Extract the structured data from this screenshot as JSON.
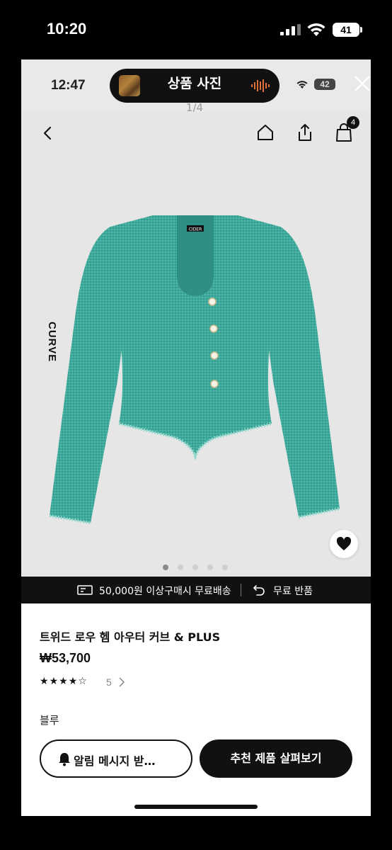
{
  "outer_status": {
    "time": "10:20",
    "battery": "41"
  },
  "inner_status": {
    "time": "12:47",
    "battery": "42"
  },
  "viewer_header": {
    "title": "상품 사진",
    "counter": "1/4",
    "cart_count": "4"
  },
  "product_image": {
    "side_label": "CURVE",
    "brand_tag": "CIDER",
    "color": "#3aa99a",
    "dots_total": 5,
    "dots_active_index": 0
  },
  "banner": {
    "shipping_text": "50,000원 이상구매시 무료배송",
    "return_text": "무료 반품"
  },
  "product": {
    "name": "트위드 로우 헴 아우터 커브 & PLUS",
    "price": "₩53,700",
    "rating": 4.5,
    "review_count": "5",
    "color_option": "블루"
  },
  "actions": {
    "notify_label": "알림 메시지 받…",
    "recommend_label": "추천 제품 살펴보기"
  },
  "icons": [
    "back-icon",
    "home-icon",
    "share-icon",
    "shopping-bag-icon",
    "heart-icon",
    "truck-icon",
    "return-icon",
    "bell-icon",
    "close-icon",
    "wifi-icon"
  ]
}
